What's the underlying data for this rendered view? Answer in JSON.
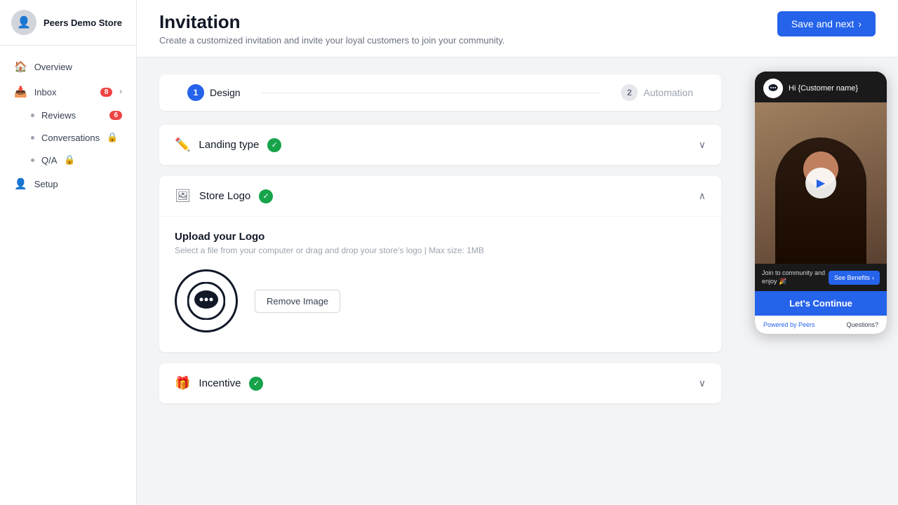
{
  "sidebar": {
    "store_name": "Peers Demo Store",
    "avatar_icon": "👤",
    "nav_items": [
      {
        "id": "overview",
        "label": "Overview",
        "icon": "🏠",
        "badge": null,
        "locked": false
      },
      {
        "id": "inbox",
        "label": "Inbox",
        "icon": "📥",
        "badge": "8",
        "locked": false,
        "has_chevron": true
      },
      {
        "id": "reviews",
        "label": "Reviews",
        "icon": "•",
        "badge": "6",
        "locked": false,
        "sub": true
      },
      {
        "id": "conversations",
        "label": "Conversations",
        "icon": "•",
        "locked": true,
        "sub": true
      },
      {
        "id": "qa",
        "label": "Q/A",
        "icon": "•",
        "locked": true,
        "sub": true
      },
      {
        "id": "setup",
        "label": "Setup",
        "icon": "👤",
        "locked": false
      }
    ]
  },
  "header": {
    "title": "Invitation",
    "subtitle": "Create a customized invitation and invite your loyal customers to join your community.",
    "save_button_label": "Save and next",
    "save_button_arrow": "›"
  },
  "stepper": {
    "steps": [
      {
        "id": "design",
        "number": "1",
        "label": "Design",
        "active": true
      },
      {
        "id": "automation",
        "number": "2",
        "label": "Automation",
        "active": false
      }
    ]
  },
  "sections": {
    "landing_type": {
      "title": "Landing type",
      "icon": "🖋",
      "completed": true,
      "expanded": false,
      "chevron": "∨"
    },
    "store_logo": {
      "title": "Store Logo",
      "icon": "🖼",
      "completed": true,
      "expanded": true,
      "chevron": "∧",
      "upload_title": "Upload your Logo",
      "upload_subtitle": "Select a file from your computer or drag and drop your store's logo | Max size: 1MB",
      "remove_button_label": "Remove Image"
    },
    "incentive": {
      "title": "Incentive",
      "icon": "🎁",
      "completed": true,
      "expanded": false,
      "chevron": "∨"
    }
  },
  "preview": {
    "greeting": "Hi {Customer name}",
    "join_text": "Join to community and enjoy 🎉",
    "see_benefits_label": "See Benefits",
    "lets_continue_label": "Let's Continue",
    "powered_by_label": "Powered by ",
    "powered_by_brand": "Peers",
    "questions_label": "Questions?"
  }
}
